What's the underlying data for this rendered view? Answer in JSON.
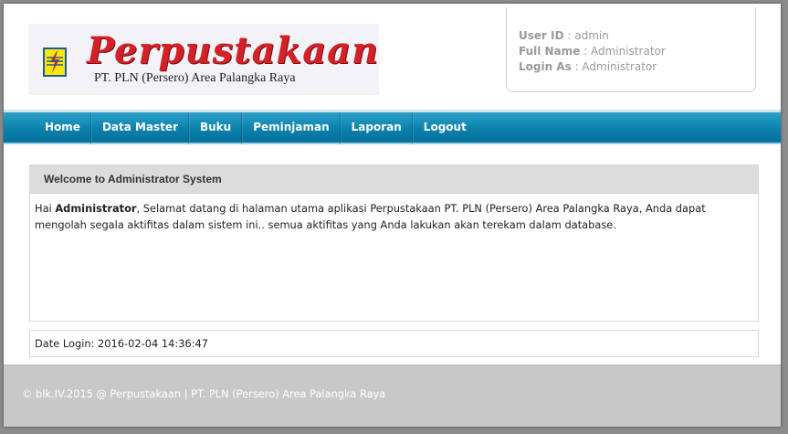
{
  "brand": {
    "title": "Perpustakaan",
    "subtitle": "PT. PLN (Persero) Area Palangka Raya",
    "logo_icon": "pln-lightning-icon",
    "title_color": "#d42027"
  },
  "user": {
    "id_label": "User ID",
    "id_value": "admin",
    "name_label": "Full Name",
    "name_value": "Administrator",
    "role_label": "Login As",
    "role_value": "Administrator"
  },
  "nav": {
    "items": [
      "Home",
      "Data Master",
      "Buku",
      "Peminjaman",
      "Laporan",
      "Logout"
    ],
    "color": "#0a81ad"
  },
  "welcome": {
    "title": "Welcome to Administrator System",
    "greeting": "Hai",
    "user": "Administrator",
    "message": ", Selamat datang di halaman utama aplikasi Perpustakaan PT. PLN (Persero) Area Palangka Raya, Anda dapat mengolah segala aktifitas dalam sistem ini.. semua aktifitas yang Anda lakukan akan terekam dalam database."
  },
  "login": {
    "label": "Date Login:",
    "value": "2016-02-04 14:36:47"
  },
  "footer": {
    "text": "© blk.IV.2015 @ Perpustakaan | PT. PLN (Persero) Area Palangka Raya"
  }
}
